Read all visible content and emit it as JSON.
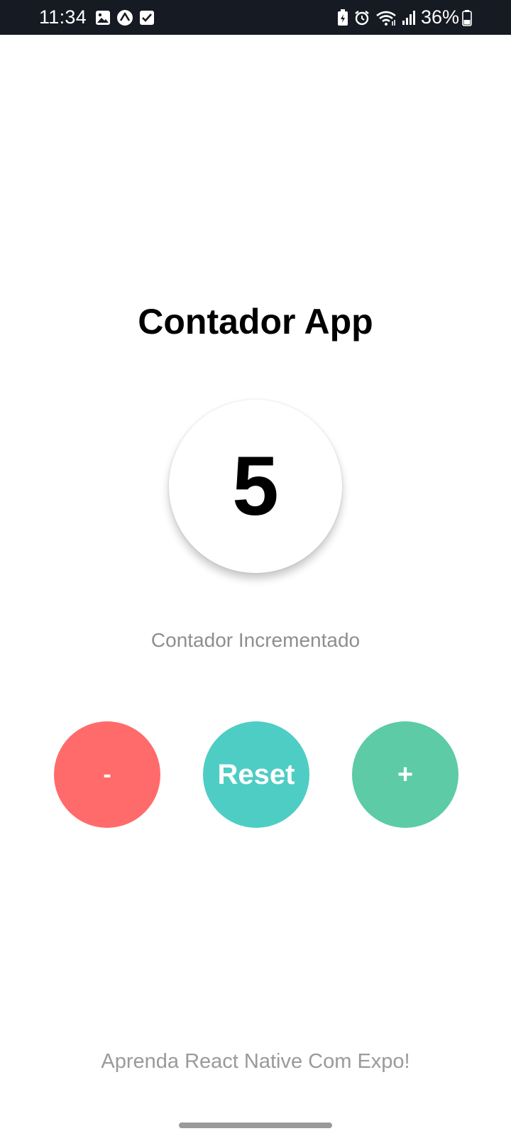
{
  "status_bar": {
    "time": "11:34",
    "battery_percent": "36%",
    "left_icons": [
      "gallery-icon",
      "expo-icon",
      "checkbox-icon"
    ],
    "right_icons": [
      "battery-saver-icon",
      "alarm-icon",
      "wifi-icon",
      "signal-icon",
      "battery-icon"
    ]
  },
  "app": {
    "title": "Contador App",
    "counter_value": "5",
    "status_message": "Contador Incrementado",
    "footer": "Aprenda React Native Com Expo!"
  },
  "buttons": {
    "decrement_label": "-",
    "reset_label": "Reset",
    "increment_label": "+"
  },
  "colors": {
    "decrement": "#ff6b6b",
    "reset": "#4ecdc4",
    "increment": "#5ccba6",
    "status_bar_bg": "#161a22",
    "secondary_text": "#8e8e8e"
  }
}
